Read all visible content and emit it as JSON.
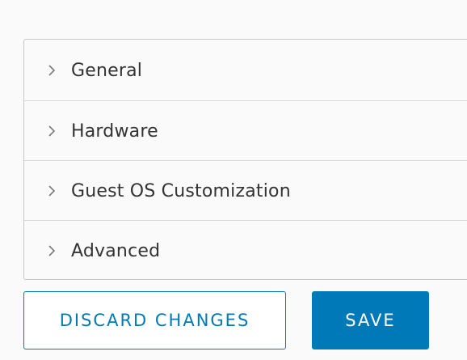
{
  "sections": [
    {
      "label": "General",
      "icon": "chevron-right-icon",
      "expanded": false
    },
    {
      "label": "Hardware",
      "icon": "chevron-right-icon",
      "expanded": false
    },
    {
      "label": "Guest OS Customization",
      "icon": "chevron-right-icon",
      "expanded": false
    },
    {
      "label": "Advanced",
      "icon": "chevron-right-icon",
      "expanded": false
    }
  ],
  "actions": {
    "discard_label": "DISCARD CHANGES",
    "save_label": "SAVE"
  },
  "colors": {
    "accent": "#0079b8",
    "text": "#333333",
    "border": "#c8c8c8",
    "background": "#fafafa"
  }
}
